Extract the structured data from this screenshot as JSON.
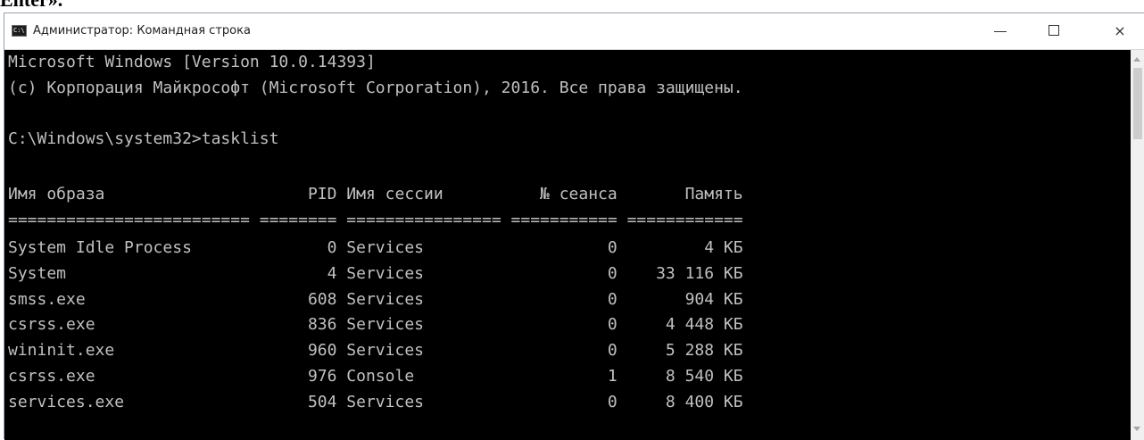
{
  "document": {
    "text": "Enter»."
  },
  "window": {
    "title": "Администратор: Командная строка",
    "icon": "cmd-icon"
  },
  "controls": {
    "minimize": "minimize-icon",
    "maximize": "maximize-icon",
    "close": "×"
  },
  "console": {
    "lines": [
      "Microsoft Windows [Version 10.0.14393]",
      "(c) Корпорация Майкрософт (Microsoft Corporation), 2016. Все права защищены.",
      "",
      "C:\\Windows\\system32>tasklist",
      "",
      "Имя образа                     PID Имя сессии          № сеанса       Память",
      "========================= ======== ================ =========== ============",
      "System Idle Process              0 Services                   0         4 КБ",
      "System                           4 Services                   0    33 116 КБ",
      "smss.exe                       608 Services                   0       904 КБ",
      "csrss.exe                      836 Services                   0     4 448 КБ",
      "wininit.exe                    960 Services                   0     5 288 КБ",
      "csrss.exe                      976 Console                    1     8 540 КБ",
      "services.exe                   504 Services                   0     8 400 КБ"
    ]
  }
}
